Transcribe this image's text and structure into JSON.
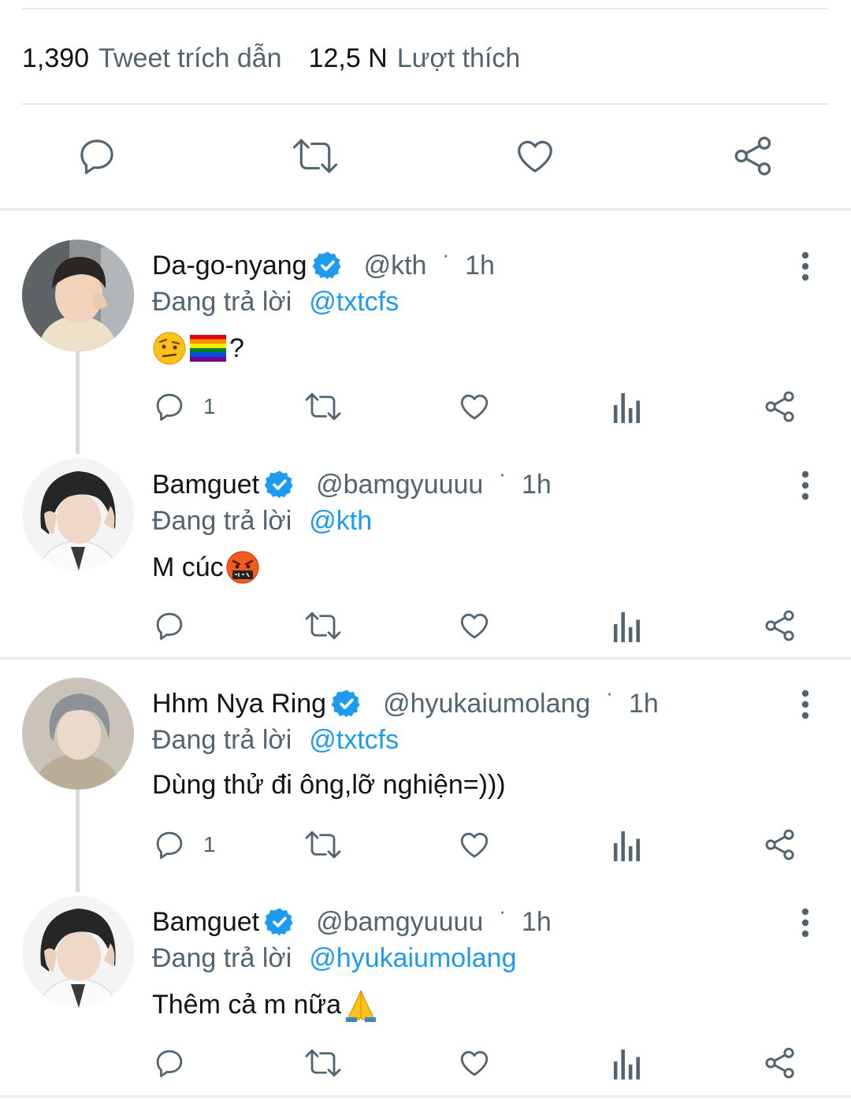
{
  "stats": {
    "quote_count": "1,390",
    "quote_label": "Tweet trích dẫn",
    "like_count": "12,5 N",
    "like_label": "Lượt thích"
  },
  "colors": {
    "accent": "#1d9bf0",
    "secondary_text": "#536471",
    "divider": "#e6e9ec"
  },
  "icons": {
    "reply": "reply-icon",
    "retweet": "retweet-icon",
    "like": "heart-icon",
    "views": "analytics-icon",
    "share": "share-icon",
    "verified": "verified-badge-icon",
    "more": "more-vertical-icon"
  },
  "replies": [
    {
      "name": "Da-go-nyang",
      "handle": "@kth",
      "time": "1h",
      "reply_label": "Đang trả lời",
      "reply_to": "@txtcfs",
      "text": "",
      "emojis": [
        "raised-eyebrow-emoji",
        "rainbow-flag-emoji"
      ],
      "text_after": "?",
      "reply_count": "1"
    },
    {
      "name": "Bamguet",
      "handle": "@bamgyuuuu",
      "time": "1h",
      "reply_label": "Đang trả lời",
      "reply_to": "@kth",
      "text": "M cúc",
      "emojis": [
        "cursing-face-emoji"
      ],
      "text_after": "",
      "reply_count": ""
    },
    {
      "name": "Hhm Nya Ring",
      "handle": "@hyukaiumolang",
      "time": "1h",
      "reply_label": "Đang trả lời",
      "reply_to": "@txtcfs",
      "text": "Dùng thử đi ông,lỡ nghiện=)))",
      "emojis": [],
      "text_after": "",
      "reply_count": "1"
    },
    {
      "name": "Bamguet",
      "handle": "@bamgyuuuu",
      "time": "1h",
      "reply_label": "Đang trả lời",
      "reply_to": "@hyukaiumolang",
      "text": "Thêm cả m nữa",
      "emojis": [
        "folded-hands-emoji"
      ],
      "text_after": "",
      "reply_count": ""
    }
  ]
}
